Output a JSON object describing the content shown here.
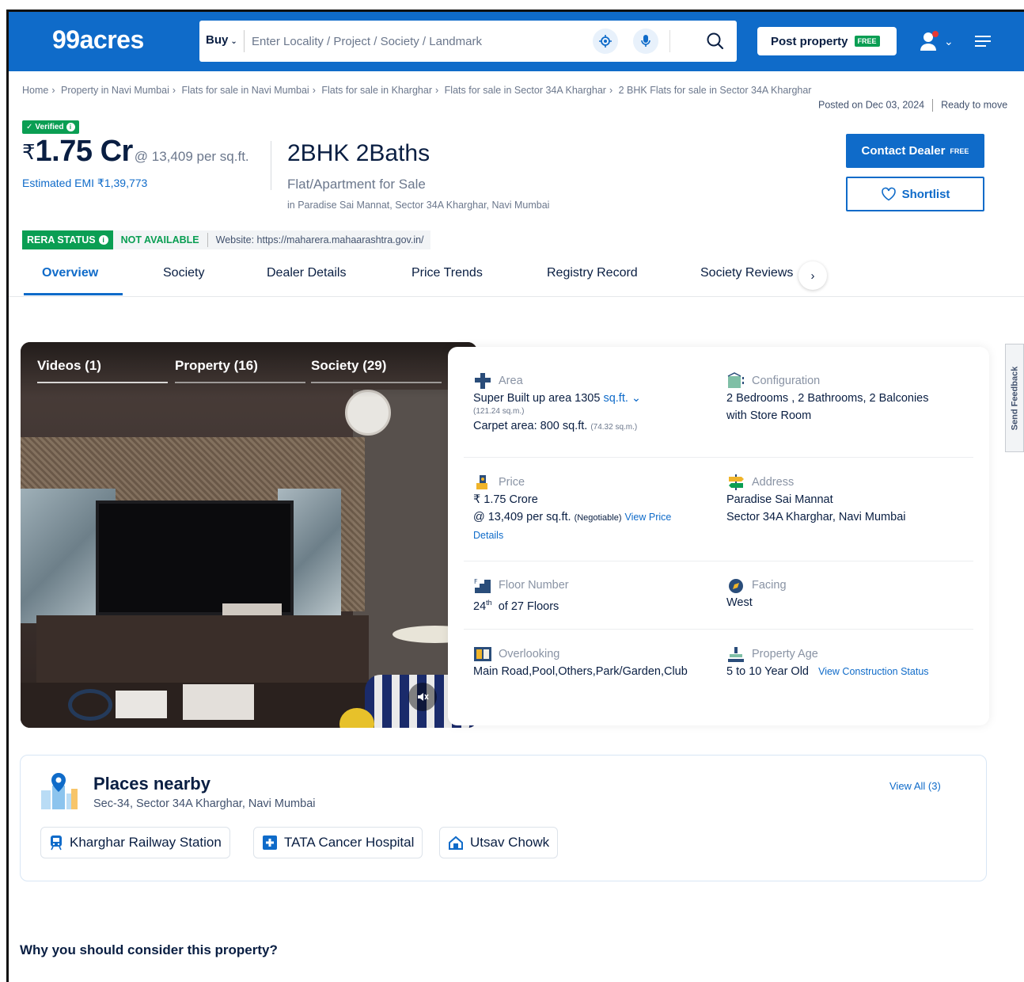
{
  "header": {
    "logo": "99acres",
    "buy_label": "Buy",
    "search_placeholder": "Enter Locality / Project / Society / Landmark",
    "post_property_label": "Post property",
    "free_tag": "FREE"
  },
  "breadcrumb": [
    "Home",
    "Property in Navi Mumbai",
    "Flats for sale in Navi Mumbai",
    "Flats for sale in Kharghar",
    "Flats for sale in Sector 34A Kharghar",
    "2 BHK Flats for sale in Sector 34A Kharghar"
  ],
  "posted": {
    "date": "Posted on Dec 03, 2024",
    "status": "Ready to move"
  },
  "listing": {
    "verified": "Verified",
    "currency": "₹",
    "price": "1.75 Cr",
    "price_per": "@ 13,409 per sq.ft.",
    "emi": "Estimated EMI ₹1,39,773",
    "title": "2BHK 2Baths",
    "type": "Flat/Apartment for Sale",
    "location": "in Paradise Sai Mannat, Sector 34A Kharghar, Navi Mumbai"
  },
  "actions": {
    "contact_label": "Contact Dealer",
    "contact_free": "FREE",
    "shortlist_label": "Shortlist"
  },
  "rera": {
    "status_label": "RERA STATUS",
    "value": "NOT AVAILABLE",
    "website": "Website: https://maharera.mahaarashtra.gov.in/"
  },
  "tabs": [
    "Overview",
    "Society",
    "Dealer Details",
    "Price Trends",
    "Registry Record",
    "Society Reviews"
  ],
  "media": {
    "tabs": [
      "Videos (1)",
      "Property (16)",
      "Society (29)"
    ]
  },
  "details": {
    "area": {
      "label": "Area",
      "super": "Super Built up area 1305",
      "unit": "sq.ft.",
      "super_sqm": "(121.24 sq.m.)",
      "carpet": "Carpet area: 800 sq.ft.",
      "carpet_sqm": "(74.32 sq.m.)"
    },
    "configuration": {
      "label": "Configuration",
      "line1": "2 Bedrooms , 2 Bathrooms, 2 Balconies",
      "line2": "with Store Room"
    },
    "price": {
      "label": "Price",
      "line1": "₹ 1.75 Crore",
      "line2": "@ 13,409 per sq.ft.",
      "negotiable": "(Negotiable)",
      "link1": "View Price",
      "link2": "Details"
    },
    "address": {
      "label": "Address",
      "line1": "Paradise Sai Mannat",
      "line2": "Sector 34A Kharghar, Navi Mumbai"
    },
    "floor": {
      "label": "Floor Number",
      "num": "24",
      "sup": "th",
      "rest": "of 27 Floors"
    },
    "facing": {
      "label": "Facing",
      "value": "West"
    },
    "overlooking": {
      "label": "Overlooking",
      "value": "Main Road,Pool,Others,Park/Garden,Club"
    },
    "age": {
      "label": "Property Age",
      "value": "5 to 10 Year Old",
      "link": "View Construction Status"
    }
  },
  "feedback": "Send Feedback",
  "places": {
    "title": "Places nearby",
    "subtitle": "Sec-34, Sector 34A Kharghar, Navi Mumbai",
    "view_all": "View All (3)",
    "items": [
      "Kharghar Railway Station",
      "TATA Cancer Hospital",
      "Utsav Chowk"
    ]
  },
  "why": "Why you should consider this property?",
  "colors": {
    "brand_blue": "#0f6bc9",
    "green": "#0a9e53"
  }
}
